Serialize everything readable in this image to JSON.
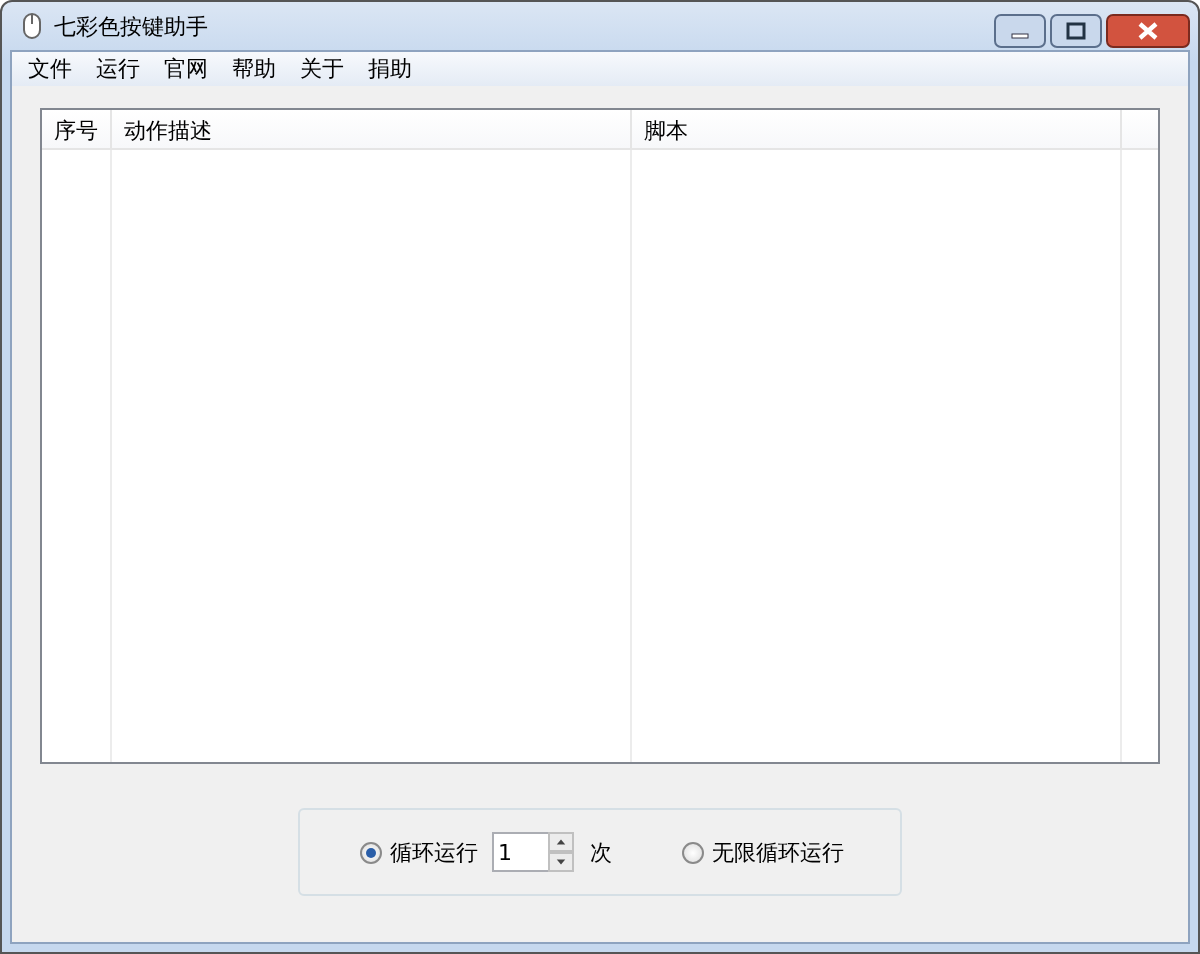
{
  "window": {
    "title": "七彩色按键助手"
  },
  "menu": [
    "文件",
    "运行",
    "官网",
    "帮助",
    "关于",
    "捐助"
  ],
  "table": {
    "columns": [
      "序号",
      "动作描述",
      "脚本"
    ]
  },
  "loop_options": [
    {
      "kind": "count",
      "label": "循环运行",
      "selected": true,
      "value": "1",
      "unit": "次"
    },
    {
      "kind": "plain",
      "label": "无限循环运行",
      "selected": false
    }
  ]
}
